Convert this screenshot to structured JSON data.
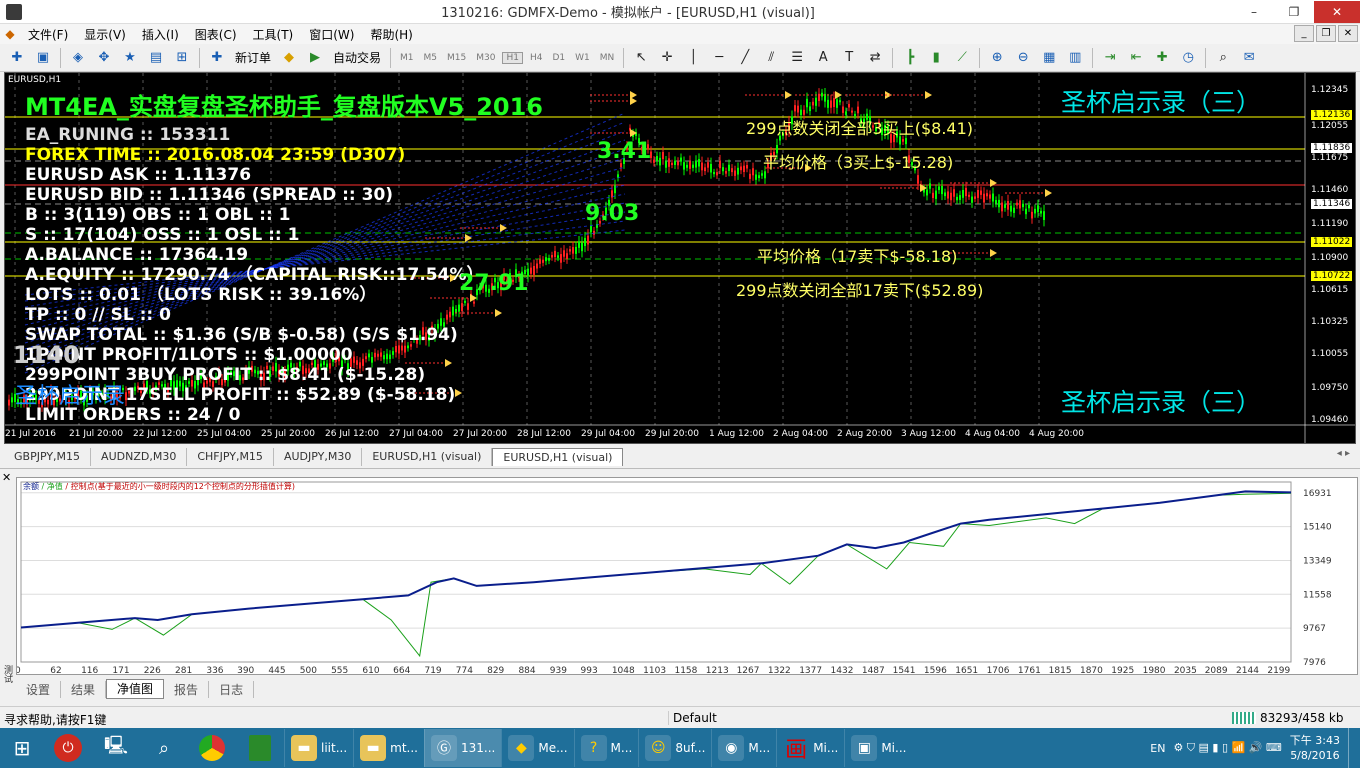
{
  "window": {
    "title": "1310216: GDMFX-Demo - 模拟帐户 - [EURUSD,H1 (visual)]",
    "minimize": "–",
    "maximize": "❐",
    "close": "✕"
  },
  "menu": [
    "文件(F)",
    "显示(V)",
    "插入(I)",
    "图表(C)",
    "工具(T)",
    "窗口(W)",
    "帮助(H)"
  ],
  "toolbar": {
    "new_order": "新订单",
    "auto_trade": "自动交易",
    "timeframes": [
      "M1",
      "M5",
      "M15",
      "M30",
      "H1",
      "H4",
      "D1",
      "W1",
      "MN"
    ]
  },
  "chart": {
    "symbol_label": "EURUSD,H1",
    "overlay_title": "MT4EA_实盘复盘圣杯助手_复盘版本V5_2016",
    "info_lines": [
      "EA_RUNING :: 153311",
      "FOREX TIME :: 2016.08.04 23:59 (D307)",
      "EURUSD ASK :: 1.11376",
      "EURUSD BID :: 1.11346  (SPREAD :: 30)",
      "B :: 3(119)  OBS :: 1  OBL :: 1",
      "S :: 17(104)  OSS :: 1  OSL :: 1",
      "A.BALANCE :: 17364.19",
      "A.EQUITY :: 17290.74 （CAPITAL RISK::17.54%）",
      "LOTS :: 0.01 （LOTS RISK :: 39.16%）",
      "TP :: 0 // SL :: 0",
      "SWAP TOTAL :: $1.36  (S/B $-0.58)  (S/S $1.94)",
      "1POINT PROFIT/1LOTS :: $1.00000",
      "299POINT 3BUY PROFIT :: $8.41 ($-15.28)",
      "299POINT 17SELL PROFIT :: $52.89 ($-58.18)",
      "LIMIT ORDERS :: 24 / 0"
    ],
    "annotations": {
      "close_buy": "299点数关闭全部3买上($8.41)",
      "avg_buy": "平均价格（3买上$-15.28)",
      "avg_sell": "平均价格（17卖下$-58.18)",
      "close_sell": "299点数关闭全部17卖下($52.89)",
      "headline_top": "圣杯启示录（三）",
      "headline_bottom": "圣杯启示录（三）",
      "green_341": "3.41",
      "green_903": "9.03",
      "green_2791": "27.91",
      "left_big": "1140",
      "left_cyan": "圣杯启示录"
    },
    "price_axis": [
      "1.12345",
      "1.12136",
      "1.12055",
      "1.11836",
      "1.11675",
      "1.11460",
      "1.11346",
      "1.11190",
      "1.11022",
      "1.10900",
      "1.10722",
      "1.10615",
      "1.10325",
      "1.10055",
      "1.09750",
      "1.09460"
    ],
    "time_axis": [
      "21 Jul 2016",
      "21 Jul 20:00",
      "22 Jul 12:00",
      "25 Jul 04:00",
      "25 Jul 20:00",
      "26 Jul 12:00",
      "27 Jul 04:00",
      "27 Jul 20:00",
      "28 Jul 12:00",
      "29 Jul 04:00",
      "29 Jul 20:00",
      "1 Aug 12:00",
      "2 Aug 04:00",
      "2 Aug 20:00",
      "3 Aug 12:00",
      "4 Aug 04:00",
      "4 Aug 20:00"
    ],
    "colors": {
      "bull": "#00ff00",
      "bear": "#ff2020",
      "level_yellow": "#ffff00",
      "level_red": "#ff3030",
      "level_green": "#00c000"
    }
  },
  "chart_tabs": [
    "GBPJPY,M15",
    "AUDNZD,M30",
    "CHFJPY,M15",
    "AUDJPY,M30",
    "EURUSD,H1 (visual)",
    "EURUSD,H1 (visual)"
  ],
  "tester": {
    "legend_balance": "余额",
    "legend_equity": "净值",
    "legend_rest": "/ 控制点(基于最近的小一级时段内的12个控制点的分形插值计算)",
    "side_label": "测试",
    "tabs": [
      "设置",
      "结果",
      "净值图",
      "报告",
      "日志"
    ]
  },
  "chart_data": {
    "type": "line",
    "x_ticks": [
      "0",
      "62",
      "116",
      "171",
      "226",
      "281",
      "336",
      "390",
      "445",
      "500",
      "555",
      "610",
      "664",
      "719",
      "774",
      "829",
      "884",
      "939",
      "993",
      "1048",
      "1103",
      "1158",
      "1213",
      "1267",
      "1322",
      "1377",
      "1432",
      "1487",
      "1541",
      "1596",
      "1651",
      "1706",
      "1761",
      "1815",
      "1870",
      "1925",
      "1980",
      "2035",
      "2089",
      "2144",
      "2199"
    ],
    "y_ticks": [
      "16931",
      "15140",
      "13349",
      "11558",
      "9767",
      "7976"
    ],
    "ylim": [
      7976,
      17500
    ],
    "xlim": [
      0,
      2230
    ],
    "series": [
      {
        "name": "余额",
        "color": "#0a1e8c",
        "points": [
          [
            0,
            9800
          ],
          [
            100,
            10050
          ],
          [
            200,
            10300
          ],
          [
            240,
            10200
          ],
          [
            300,
            10500
          ],
          [
            400,
            10800
          ],
          [
            500,
            11050
          ],
          [
            600,
            11300
          ],
          [
            680,
            11500
          ],
          [
            730,
            12200
          ],
          [
            760,
            12400
          ],
          [
            800,
            12000
          ],
          [
            900,
            12200
          ],
          [
            1000,
            12450
          ],
          [
            1100,
            12700
          ],
          [
            1200,
            12950
          ],
          [
            1300,
            13200
          ],
          [
            1400,
            13600
          ],
          [
            1450,
            14200
          ],
          [
            1500,
            14000
          ],
          [
            1550,
            14300
          ],
          [
            1600,
            14800
          ],
          [
            1650,
            15300
          ],
          [
            1700,
            15500
          ],
          [
            1800,
            15800
          ],
          [
            1900,
            16100
          ],
          [
            2000,
            16400
          ],
          [
            2100,
            16800
          ],
          [
            2150,
            17000
          ],
          [
            2230,
            16950
          ]
        ]
      },
      {
        "name": "净值",
        "color": "#1aa01a",
        "points": [
          [
            0,
            9800
          ],
          [
            100,
            10050
          ],
          [
            160,
            9700
          ],
          [
            200,
            10300
          ],
          [
            250,
            9400
          ],
          [
            300,
            10500
          ],
          [
            400,
            10800
          ],
          [
            500,
            11050
          ],
          [
            600,
            11300
          ],
          [
            650,
            10200
          ],
          [
            700,
            8300
          ],
          [
            720,
            12200
          ],
          [
            760,
            12400
          ],
          [
            800,
            12000
          ],
          [
            900,
            12200
          ],
          [
            1000,
            12450
          ],
          [
            1100,
            12700
          ],
          [
            1200,
            12900
          ],
          [
            1280,
            12600
          ],
          [
            1300,
            13200
          ],
          [
            1350,
            12100
          ],
          [
            1400,
            13600
          ],
          [
            1450,
            14200
          ],
          [
            1520,
            12900
          ],
          [
            1560,
            14300
          ],
          [
            1620,
            14100
          ],
          [
            1650,
            15300
          ],
          [
            1700,
            15200
          ],
          [
            1800,
            15600
          ],
          [
            1850,
            15300
          ],
          [
            1900,
            16100
          ],
          [
            2000,
            16400
          ],
          [
            2100,
            16800
          ],
          [
            2150,
            16850
          ],
          [
            2230,
            16900
          ]
        ]
      }
    ]
  },
  "status": {
    "help": "寻求帮助,请按F1键",
    "profile": "Default",
    "traffic": "83293/458 kb"
  },
  "taskbar": {
    "items": [
      "liit...",
      "mt...",
      "131...",
      "Me...",
      "M...",
      "8uf...",
      "M...",
      "Mi...",
      "Mi..."
    ],
    "lang": "EN",
    "time": "下午 3:43",
    "date": "5/8/2016"
  }
}
